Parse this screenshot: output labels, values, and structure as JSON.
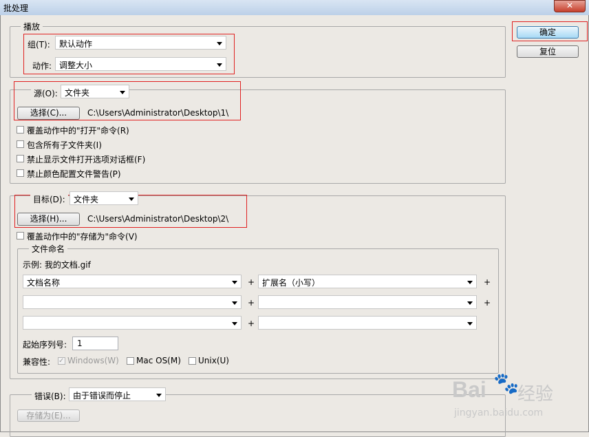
{
  "window": {
    "title": "批处理",
    "close_symbol": "✕"
  },
  "buttons": {
    "ok": "确定",
    "reset": "复位"
  },
  "play": {
    "legend": "播放",
    "group_label": "组(T):",
    "group_value": "默认动作",
    "action_label": "动作:",
    "action_value": "调整大小"
  },
  "source": {
    "label": "源(O):",
    "value": "文件夹",
    "choose_button": "选择(C)...",
    "path": "C:\\Users\\Administrator\\Desktop\\1\\",
    "options": [
      {
        "label": "覆盖动作中的\"打开\"命令(R)",
        "checked": false
      },
      {
        "label": "包含所有子文件夹(I)",
        "checked": false
      },
      {
        "label": "禁止显示文件打开选项对话框(F)",
        "checked": false
      },
      {
        "label": "禁止颜色配置文件警告(P)",
        "checked": false
      }
    ]
  },
  "destination": {
    "label": "目标(D):",
    "value": "文件夹",
    "choose_button": "选择(H)...",
    "path": "C:\\Users\\Administrator\\Desktop\\2\\",
    "override_save": {
      "label": "覆盖动作中的\"存储为\"命令(V)",
      "checked": false
    },
    "naming": {
      "legend": "文件命名",
      "example": "示例: 我的文档.gif",
      "fields": [
        "文档名称",
        "扩展名（小写）",
        "",
        "",
        "",
        ""
      ],
      "plus": "+",
      "serial_label": "起始序列号:",
      "serial_value": "1",
      "compat_label": "兼容性:",
      "compat": [
        {
          "label": "Windows(W)",
          "checked": true,
          "disabled": true
        },
        {
          "label": "Mac OS(M)",
          "checked": false,
          "disabled": false
        },
        {
          "label": "Unix(U)",
          "checked": false,
          "disabled": false
        }
      ]
    }
  },
  "errors": {
    "label": "错误(B):",
    "value": "由于错误而停止",
    "save_button": "存储为(E)..."
  },
  "watermark": {
    "brand": "Bai",
    "paw": "🐾",
    "brand2": "经验",
    "url": "jingyan.baidu.com"
  }
}
